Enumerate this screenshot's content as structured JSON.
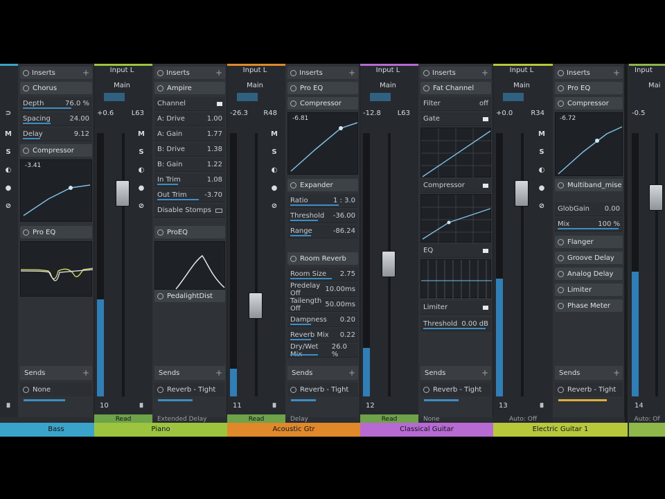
{
  "channels": {
    "bass": {
      "name": "Bass",
      "color": "#3aa3c9",
      "inputs": "Inserts",
      "plugins": [
        "Chorus",
        "Compressor",
        "Pro EQ"
      ],
      "chorus": {
        "depth_label": "Depth",
        "depth_val": "76.0 %",
        "spacing_label": "Spacing",
        "spacing_val": "24.00",
        "delay_label": "Delay",
        "delay_val": "9.12"
      },
      "comp_val": "-3.41",
      "sends": "Sends",
      "send_slot": "None"
    },
    "piano": {
      "name": "Piano",
      "color": "#9cc43e",
      "input": "Input L",
      "output": "Main",
      "gain": "+0.6",
      "pan": "L63",
      "num": "10",
      "mode": "Read",
      "inserts": "Inserts",
      "plugins": [
        "Ampire",
        "ProEQ",
        "PedalightDist"
      ],
      "params": [
        [
          "Channel",
          ""
        ],
        [
          "A: Drive",
          "1.00"
        ],
        [
          "A: Gain",
          "1.77"
        ],
        [
          "B: Drive",
          "1.38"
        ],
        [
          "B: Gain",
          "1.22"
        ],
        [
          "In Trim",
          "1.08"
        ],
        [
          "Out Trim",
          "-3.70"
        ],
        [
          "Disable Stomps",
          ""
        ]
      ],
      "sends": "Sends",
      "send_slot": "Reverb - Tight",
      "below": "Extended Delay"
    },
    "acoustic": {
      "name": "Acoustic Gtr",
      "color": "#e0892a",
      "input": "Input L",
      "output": "Main",
      "gain": "-26.3",
      "pan": "R48",
      "num": "11",
      "mode": "Read",
      "inserts": "Inserts",
      "plugins": [
        "Pro EQ",
        "Compressor",
        "Expander",
        "Room Reverb"
      ],
      "comp_val": "-6.81",
      "expander": [
        [
          "Ratio",
          "1 : 3.0"
        ],
        [
          "Threshold",
          "-36.00"
        ],
        [
          "Range",
          "-86.24"
        ]
      ],
      "reverb": [
        [
          "Room Size",
          "2.75"
        ],
        [
          "Predelay Off",
          "10.00ms"
        ],
        [
          "Tailength Off",
          "50.00ms"
        ],
        [
          "Dampness",
          "0.20"
        ],
        [
          "Reverb Mix",
          "0.22"
        ],
        [
          "Dry/Wet Mix",
          "26.0 %"
        ]
      ],
      "sends": "Sends",
      "send_slot": "Reverb - Tight",
      "below": "Delay"
    },
    "classical": {
      "name": "Classical Guitar",
      "color": "#b76ad1",
      "input": "Input L",
      "output": "Main",
      "gain": "-12.8",
      "pan": "L63",
      "num": "12",
      "mode": "Read",
      "inserts": "Inserts",
      "plugins": [
        "Fat Channel",
        "Compressor",
        "EQ",
        "Limiter"
      ],
      "filter": [
        "Filter",
        "off"
      ],
      "gate": "Gate",
      "threshold": [
        "Threshold",
        "0.00 dB"
      ],
      "sends": "Sends",
      "send_slot": "Reverb - Tight",
      "below": "None"
    },
    "electric": {
      "name": "Electric Guitar 1",
      "color": "#b7c83a",
      "input": "Input L",
      "output": "Main",
      "gain": "+0.0",
      "pan": "R34",
      "num": "13",
      "mode": "Auto: Off",
      "inserts": "Inserts",
      "plugins": [
        "Pro EQ",
        "Compressor",
        "Multiband_mise",
        "Flanger",
        "Groove Delay",
        "Analog Delay",
        "Limiter",
        "Phase Meter"
      ],
      "comp_val": "-6.72",
      "globgain": [
        "GlobGain",
        "0.00"
      ],
      "mix": [
        "Mix",
        "100 %"
      ],
      "sends": "Sends",
      "send_slot": "Reverb - Tight"
    },
    "next": {
      "input": "Input",
      "output": "Mai",
      "gain": "-0.5",
      "num": "14",
      "mode": "Auto: Of"
    }
  },
  "icons": {
    "mute": "M",
    "solo": "S"
  }
}
